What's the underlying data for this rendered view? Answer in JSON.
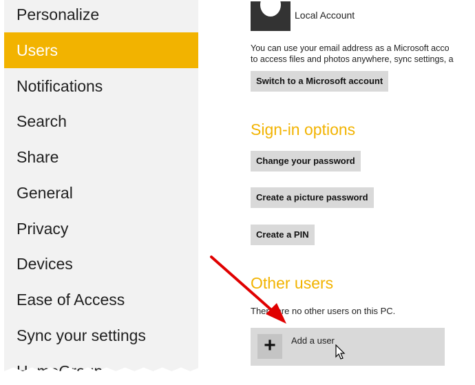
{
  "sidebar": {
    "items": [
      {
        "label": "Personalize"
      },
      {
        "label": "Users"
      },
      {
        "label": "Notifications"
      },
      {
        "label": "Search"
      },
      {
        "label": "Share"
      },
      {
        "label": "General"
      },
      {
        "label": "Privacy"
      },
      {
        "label": "Devices"
      },
      {
        "label": "Ease of Access"
      },
      {
        "label": "Sync your settings"
      },
      {
        "label": "HomeGroup"
      }
    ],
    "active_index": 1,
    "active_color": "#f2b300"
  },
  "account": {
    "name": "Local Account",
    "description_line1": "You can use your email address as a Microsoft acco",
    "description_line2": "to access files and photos anywhere, sync settings, a",
    "switch_button": "Switch to a Microsoft account"
  },
  "signin": {
    "title": "Sign-in options",
    "change_password": "Change your password",
    "picture_password": "Create a picture password",
    "create_pin": "Create a PIN"
  },
  "other_users": {
    "title": "Other users",
    "message": "There are no other users on this PC.",
    "add_user_label": "Add a user",
    "add_user_icon": "plus-icon"
  },
  "colors": {
    "accent": "#f2b300",
    "button_bg": "#d9d9d9",
    "annotation_arrow": "#e00000"
  }
}
